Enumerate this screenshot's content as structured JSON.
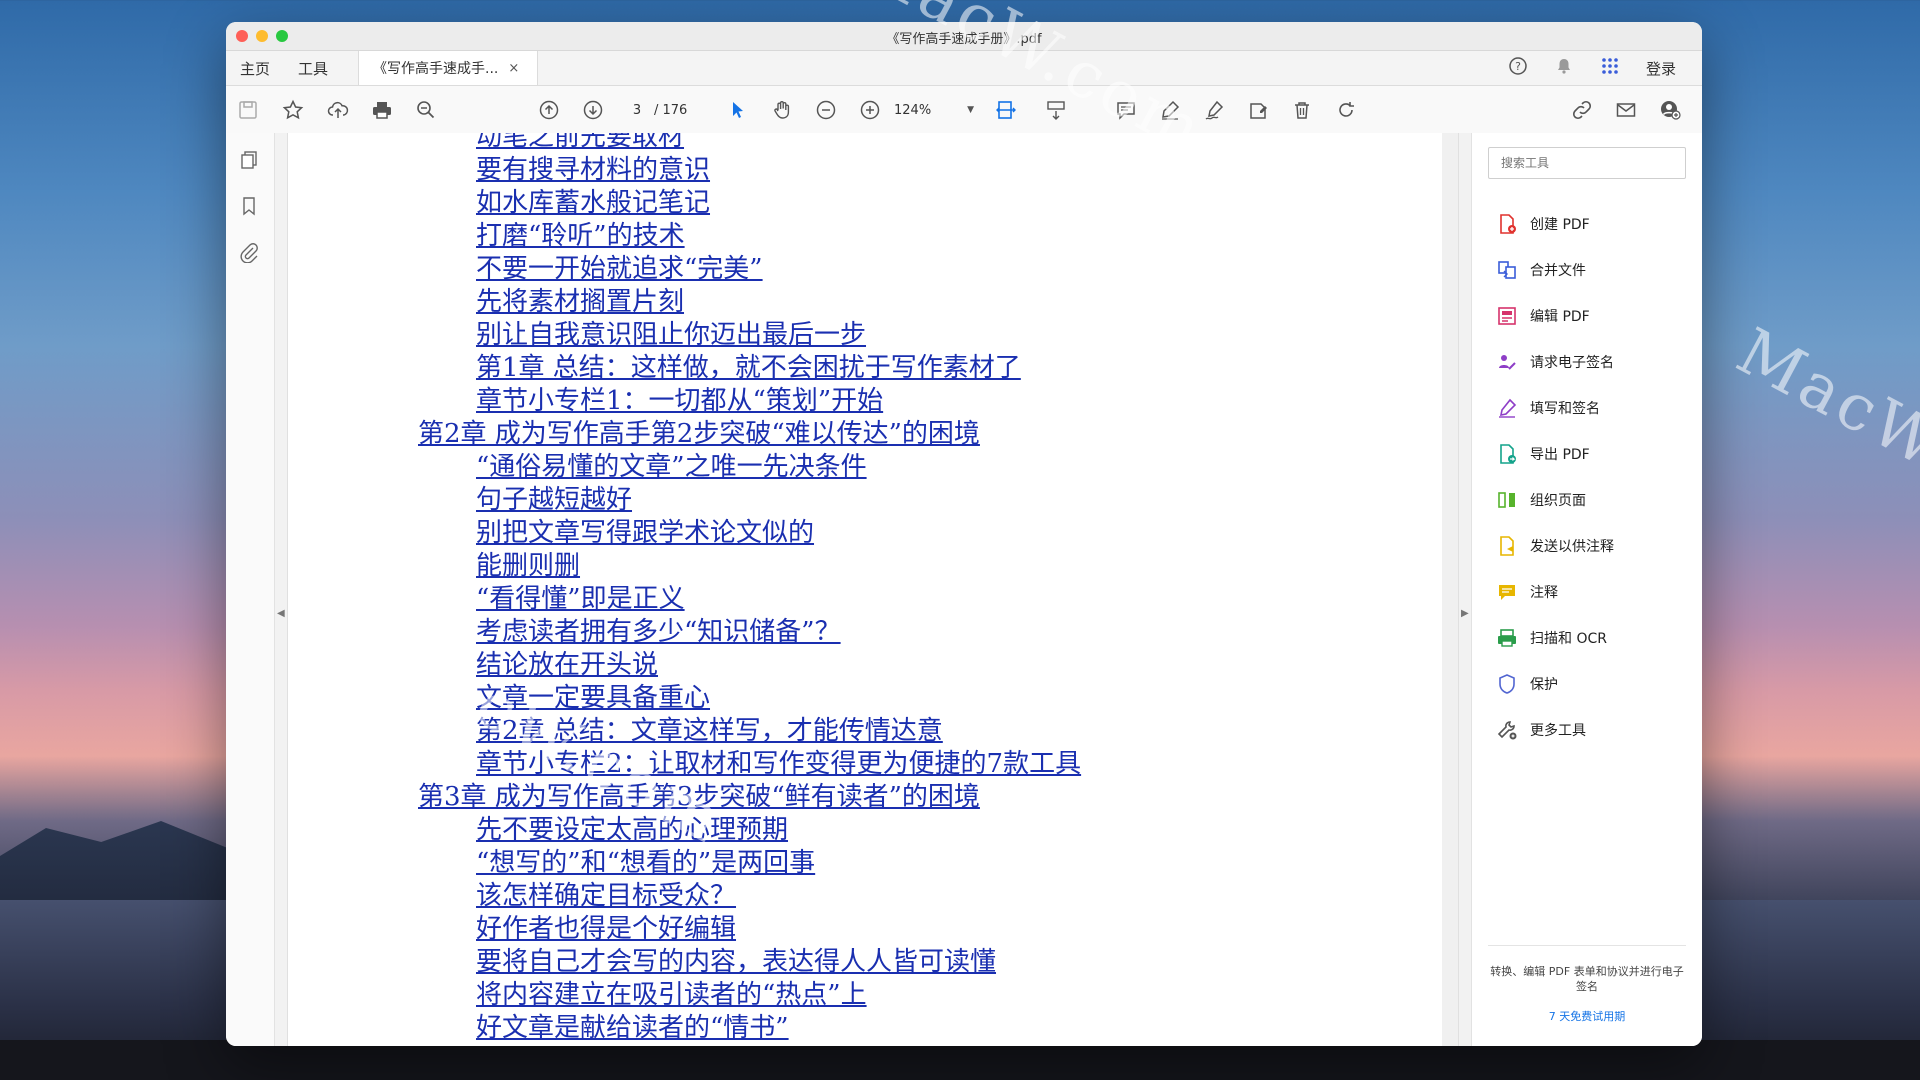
{
  "window": {
    "title": "《写作高手速成手册》.pdf"
  },
  "nav": {
    "home": "主页",
    "tools": "工具"
  },
  "tab": {
    "label": "《写作高手速成手...",
    "close": "×"
  },
  "header_right": {
    "login": "登录"
  },
  "toolbar": {
    "current_page": "3",
    "total_pages": "/ 176",
    "zoom": "124%"
  },
  "toc": [
    {
      "level": 2,
      "text": "动笔之前先要取材"
    },
    {
      "level": 2,
      "text": "要有搜寻材料的意识"
    },
    {
      "level": 2,
      "text": "如水库蓄水般记笔记"
    },
    {
      "level": 2,
      "text": "打磨“聆听”的技术"
    },
    {
      "level": 2,
      "text": "不要一开始就追求“完美”"
    },
    {
      "level": 2,
      "text": "先将素材搁置片刻"
    },
    {
      "level": 2,
      "text": "别让自我意识阻止你迈出最后一步"
    },
    {
      "level": 2,
      "text": "第1章 总结：这样做，就不会困扰于写作素材了"
    },
    {
      "level": 2,
      "text": "章节小专栏1：一切都从“策划”开始"
    },
    {
      "level": 1,
      "text": "第2章 成为写作高手第2步突破“难以传达”的困境"
    },
    {
      "level": 2,
      "text": "“通俗易懂的文章”之唯一先决条件"
    },
    {
      "level": 2,
      "text": "句子越短越好"
    },
    {
      "level": 2,
      "text": "别把文章写得跟学术论文似的"
    },
    {
      "level": 2,
      "text": "能删则删"
    },
    {
      "level": 2,
      "text": "“看得懂”即是正义"
    },
    {
      "level": 2,
      "text": "考虑读者拥有多少“知识储备”？"
    },
    {
      "level": 2,
      "text": "结论放在开头说"
    },
    {
      "level": 2,
      "text": "文章一定要具备重心"
    },
    {
      "level": 2,
      "text": "第2章 总结：文章这样写，才能传情达意"
    },
    {
      "level": 2,
      "text": "章节小专栏2：让取材和写作变得更为便捷的7款工具"
    },
    {
      "level": 1,
      "text": "第3章 成为写作高手第3步突破“鲜有读者”的困境"
    },
    {
      "level": 2,
      "text": "先不要设定太高的心理预期"
    },
    {
      "level": 2,
      "text": "“想写的”和“想看的”是两回事"
    },
    {
      "level": 2,
      "text": "该怎样确定目标受众？"
    },
    {
      "level": 2,
      "text": "好作者也得是个好编辑"
    },
    {
      "level": 2,
      "text": "要将自己才会写的内容，表达得人人皆可读懂"
    },
    {
      "level": 2,
      "text": "将内容建立在吸引读者的“热点”上"
    },
    {
      "level": 2,
      "text": "好文章是献给读者的“情书”"
    }
  ],
  "rightpanel": {
    "search_placeholder": "搜索工具",
    "tools": [
      {
        "label": "创建 PDF",
        "icon": "create-pdf-icon",
        "color": "#e0322e"
      },
      {
        "label": "合并文件",
        "icon": "combine-files-icon",
        "color": "#3a5dd9"
      },
      {
        "label": "编辑 PDF",
        "icon": "edit-pdf-icon",
        "color": "#d6336c"
      },
      {
        "label": "请求电子签名",
        "icon": "request-signature-icon",
        "color": "#8e3ec7"
      },
      {
        "label": "填写和签名",
        "icon": "fill-sign-icon",
        "color": "#8e3ec7"
      },
      {
        "label": "导出 PDF",
        "icon": "export-pdf-icon",
        "color": "#14a38b"
      },
      {
        "label": "组织页面",
        "icon": "organize-pages-icon",
        "color": "#57b32c"
      },
      {
        "label": "发送以供注释",
        "icon": "send-comment-icon",
        "color": "#e7b600"
      },
      {
        "label": "注释",
        "icon": "comment-icon",
        "color": "#e7b600"
      },
      {
        "label": "扫描和 OCR",
        "icon": "scan-ocr-icon",
        "color": "#2a9d4b"
      },
      {
        "label": "保护",
        "icon": "protect-icon",
        "color": "#5165d1"
      },
      {
        "label": "更多工具",
        "icon": "more-tools-icon",
        "color": "#555555"
      }
    ],
    "promo_text": "转换、编辑 PDF 表单和协议并进行电子签名",
    "trial_link": "7 天免费试用期"
  },
  "watermark": "MacW.com"
}
